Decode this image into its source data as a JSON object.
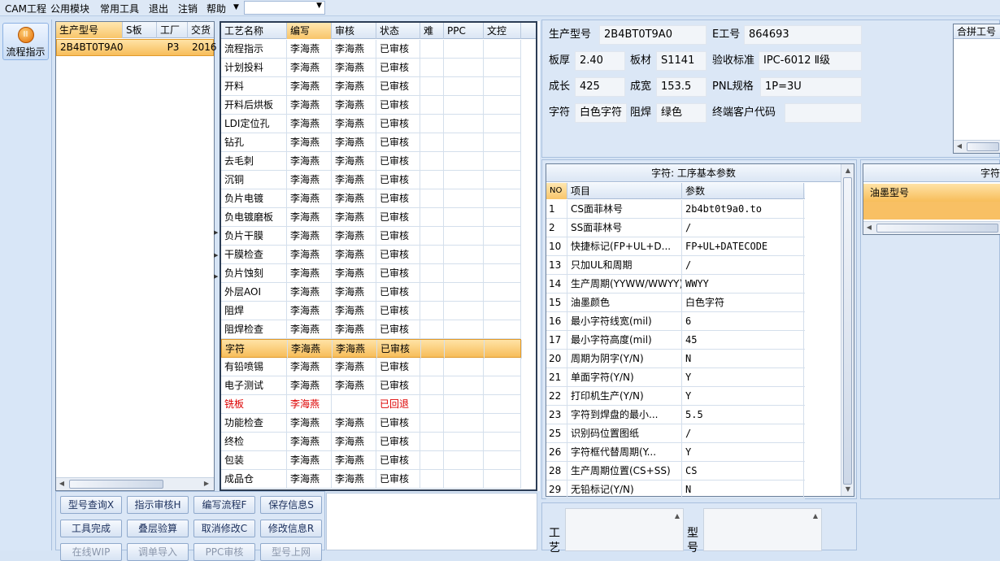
{
  "menu": [
    "CAM工程",
    "公用模块",
    "常用工具",
    "退出",
    "注销",
    "帮助"
  ],
  "menu_dropdown": "",
  "flow_button": "流程指示",
  "order_list": {
    "headers": [
      "生产型号",
      "S板",
      "工厂",
      "交货"
    ],
    "rows": [
      [
        "2B4BT0T9A0",
        "",
        "P3",
        "2016"
      ]
    ]
  },
  "process": {
    "headers": [
      "工艺名称",
      "编写",
      "审核",
      "状态",
      "难",
      "PPC",
      "文控"
    ],
    "rows": [
      [
        "流程指示",
        "李海燕",
        "李海燕",
        "已审核"
      ],
      [
        "计划投料",
        "李海燕",
        "李海燕",
        "已审核"
      ],
      [
        "开料",
        "李海燕",
        "李海燕",
        "已审核"
      ],
      [
        "开料后烘板",
        "李海燕",
        "李海燕",
        "已审核"
      ],
      [
        "LDI定位孔",
        "李海燕",
        "李海燕",
        "已审核"
      ],
      [
        "钻孔",
        "李海燕",
        "李海燕",
        "已审核"
      ],
      [
        "去毛刺",
        "李海燕",
        "李海燕",
        "已审核"
      ],
      [
        "沉铜",
        "李海燕",
        "李海燕",
        "已审核"
      ],
      [
        "负片电镀",
        "李海燕",
        "李海燕",
        "已审核"
      ],
      [
        "负电镀磨板",
        "李海燕",
        "李海燕",
        "已审核"
      ],
      [
        "负片干膜",
        "李海燕",
        "李海燕",
        "已审核"
      ],
      [
        "干膜检查",
        "李海燕",
        "李海燕",
        "已审核"
      ],
      [
        "负片蚀刻",
        "李海燕",
        "李海燕",
        "已审核"
      ],
      [
        "外层AOI",
        "李海燕",
        "李海燕",
        "已审核"
      ],
      [
        "阻焊",
        "李海燕",
        "李海燕",
        "已审核"
      ],
      [
        "阻焊检查",
        "李海燕",
        "李海燕",
        "已审核"
      ],
      [
        "字符",
        "李海燕",
        "李海燕",
        "已审核"
      ],
      [
        "有铅喷锡",
        "李海燕",
        "李海燕",
        "已审核"
      ],
      [
        "电子测试",
        "李海燕",
        "李海燕",
        "已审核"
      ],
      [
        "铣板",
        "李海燕",
        "",
        "已回退"
      ],
      [
        "功能检查",
        "李海燕",
        "李海燕",
        "已审核"
      ],
      [
        "终检",
        "李海燕",
        "李海燕",
        "已审核"
      ],
      [
        "包装",
        "李海燕",
        "李海燕",
        "已审核"
      ],
      [
        "成品仓",
        "李海燕",
        "李海燕",
        "已审核"
      ]
    ],
    "selected_index": 16,
    "returned_index": 19
  },
  "buttons": [
    [
      "型号查询X",
      "指示审核H",
      "编写流程F",
      "保存信息S"
    ],
    [
      "工具完成",
      "叠层验算",
      "取消修改C",
      "修改信息R"
    ],
    [
      "在线WIP",
      "调单导入",
      "PPC审核",
      "型号上网"
    ]
  ],
  "info": {
    "model_label": "生产型号",
    "model": "2B4BT0T9A0",
    "emp_label": "E工号",
    "emp": "864693",
    "thick_label": "板厚",
    "thick": "2.40",
    "material_label": "板材",
    "material": "S1141",
    "standard_label": "验收标准",
    "standard": "IPC-6012 Ⅱ级",
    "length_label": "成长",
    "length": "425",
    "width_label": "成宽",
    "width": "153.5",
    "pnl_label": "PNL规格",
    "pnl": "1P=3U",
    "char_label": "字符",
    "char": "白色字符",
    "mask_label": "阻焊",
    "mask": "绿色",
    "customer_label": "终端客户代码",
    "customer": ""
  },
  "merge_header": "合拼工号",
  "params": {
    "title": "字符: 工序基本参数",
    "headers": [
      "NO",
      "项目",
      "参数"
    ],
    "rows": [
      [
        "1",
        "CS面菲林号",
        "2b4bt0t9a0.to"
      ],
      [
        "2",
        "SS面菲林号",
        "/"
      ],
      [
        "10",
        "快捷标记(FP+UL+D...",
        "FP+UL+DATECODE"
      ],
      [
        "13",
        "只加UL和周期",
        "/"
      ],
      [
        "14",
        "生产周期(YYWW/WWYY)",
        "WWYY"
      ],
      [
        "15",
        "油墨颜色",
        "白色字符"
      ],
      [
        "16",
        "最小字符线宽(mil)",
        "6"
      ],
      [
        "17",
        "最小字符高度(mil)",
        "45"
      ],
      [
        "20",
        "周期为阴字(Y/N)",
        "N"
      ],
      [
        "21",
        "单面字符(Y/N)",
        "Y"
      ],
      [
        "22",
        "打印机生产(Y/N)",
        "Y"
      ],
      [
        "23",
        "字符到焊盘的最小...",
        "5.5"
      ],
      [
        "25",
        "识别码位置图纸",
        "/"
      ],
      [
        "26",
        "字符框代替周期(Y...",
        "Y"
      ],
      [
        "28",
        "生产周期位置(CS+SS)",
        "CS"
      ],
      [
        "29",
        "无铅标记(Y/N)",
        "N"
      ]
    ]
  },
  "ink": {
    "title": "字符",
    "header": "油墨型号"
  },
  "bottom": {
    "label1": "工艺",
    "label2": "型号"
  }
}
